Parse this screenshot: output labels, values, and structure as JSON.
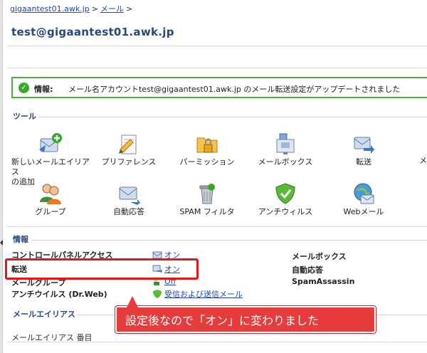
{
  "breadcrumb": {
    "domain": "gigaantest01.awk.jp",
    "sep1": ">",
    "mail": "メール",
    "sep2": ">"
  },
  "page_title": "test@gigaantest01.awk.jp",
  "message": {
    "label": "情報:",
    "text": "メール名アカウントtest@gigaantest01.awk.jp のメール転送設定がアップデートされました"
  },
  "tools": {
    "heading": "ツール",
    "items": [
      {
        "line1": "新しいメールエイリアス",
        "line2": "の追加",
        "icon": "add-mail-alias-icon"
      },
      {
        "line1": "プリファレンス",
        "line2": "",
        "icon": "preferences-icon"
      },
      {
        "line1": "パーミッション",
        "line2": "",
        "icon": "permissions-icon"
      },
      {
        "line1": "メールボックス",
        "line2": "",
        "icon": "mailbox-icon"
      },
      {
        "line1": "転送",
        "line2": "",
        "icon": "forwarding-icon"
      },
      {
        "line1": "グループ",
        "line2": "",
        "icon": "group-icon"
      },
      {
        "line1": "自動応答",
        "line2": "",
        "icon": "autoresponder-icon"
      },
      {
        "line1": "SPAM フィルタ",
        "line2": "",
        "icon": "spam-filter-icon"
      },
      {
        "line1": "アンチウィルス",
        "line2": "",
        "icon": "antivirus-icon"
      },
      {
        "line1": "Webメール",
        "line2": "",
        "icon": "webmail-icon"
      }
    ],
    "cut_label": "メ"
  },
  "info": {
    "heading": "情報",
    "rows": [
      {
        "key": "コントロールパネルアクセス",
        "value": "オン"
      },
      {
        "key": "転送",
        "value": "オン"
      },
      {
        "key": "メールグループ",
        "value": "Off"
      },
      {
        "key": "アンチウイルス (Dr.Web)",
        "value": "受信および送信メール"
      }
    ],
    "right_keys": [
      "メールボックス",
      "自動応答",
      "SpamAssassin"
    ]
  },
  "aliases": {
    "heading": "メールエイリアス",
    "col": "メールエイリアス 番目"
  },
  "annotation": "設定後なので「オン」に変わりました",
  "colors": {
    "accent": "#26477f",
    "link": "#1e46b4",
    "success": "#4caf3c",
    "highlight": "#e51616"
  }
}
